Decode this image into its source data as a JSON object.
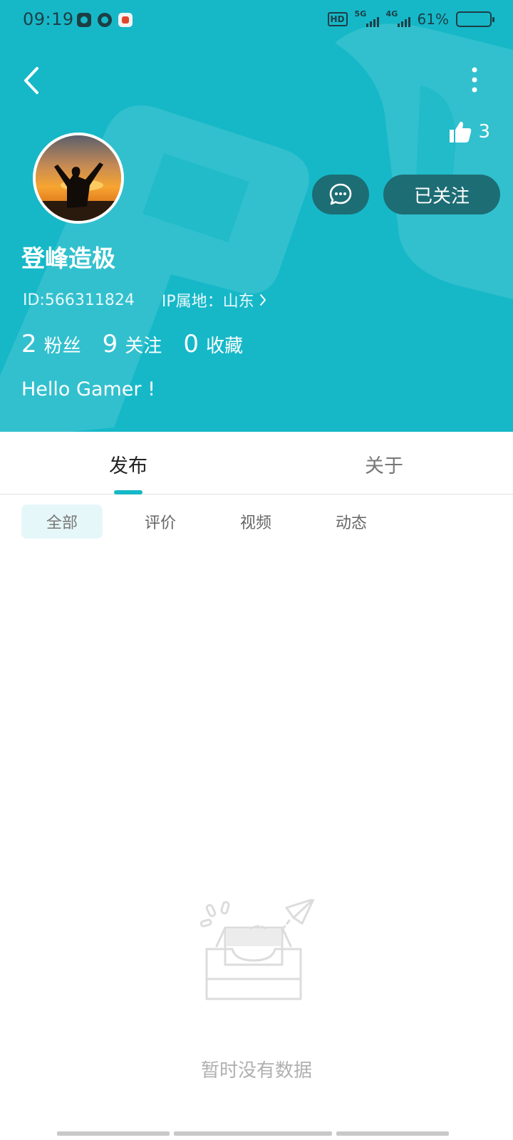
{
  "status_bar": {
    "time": "09:19",
    "hd_label": "HD",
    "net1_label": "5G",
    "net2_label": "4G",
    "battery": "61%",
    "battery_level": 0.61
  },
  "header": {
    "accent_color": "#16b8c8",
    "button_color": "#1d6d74",
    "likes": "3",
    "follow_label": "已关注",
    "username": "登峰造极",
    "user_id": "ID:566311824",
    "ip_location": "IP属地：山东",
    "stats": [
      {
        "num": "2",
        "label": "粉丝"
      },
      {
        "num": "9",
        "label": "关注"
      },
      {
        "num": "0",
        "label": "收藏"
      }
    ],
    "bio": "Hello Gamer !"
  },
  "tabs": [
    {
      "label": "发布",
      "active": true
    },
    {
      "label": "关于",
      "active": false
    }
  ],
  "filters": [
    {
      "label": "全部",
      "active": true
    },
    {
      "label": "评价",
      "active": false
    },
    {
      "label": "视频",
      "active": false
    },
    {
      "label": "动态",
      "active": false
    }
  ],
  "empty_state": {
    "text": "暂时没有数据",
    "icon": "empty-inbox-icon"
  }
}
